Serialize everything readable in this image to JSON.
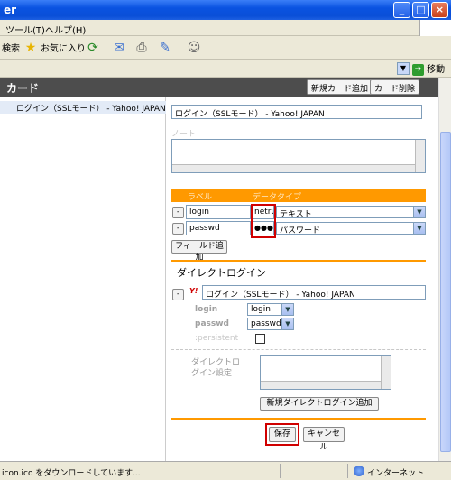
{
  "window": {
    "title": "er"
  },
  "menu": {
    "items": [
      "ツール(T)",
      "ヘルプ(H)"
    ]
  },
  "toolbar": {
    "search_label": "検索",
    "favorites_label": "お気に入り"
  },
  "addressbar": {
    "go_label": "移動"
  },
  "card": {
    "header_title": "カード",
    "new_card_label": "新規カード追加",
    "delete_card_label": "カード削除",
    "list_item": "ログイン（SSLモード） - Yahoo! JAPAN",
    "title_value": "ログイン（SSLモード） - Yahoo! JAPAN",
    "note_label": "ノート"
  },
  "fields": {
    "col_label": "ラベル",
    "col_datatype": "データタイプ",
    "rows": [
      {
        "remove": "-",
        "label": "login",
        "value": "netru",
        "type": "テキスト"
      },
      {
        "remove": "-",
        "label": "passwd",
        "value": "●●●●",
        "type": "パスワード"
      }
    ],
    "add_field_label": "フィールド追加"
  },
  "direct_login": {
    "section_title": "ダイレクトログイン",
    "remove": "-",
    "site_icon": "Y!",
    "site_title": "ログイン（SSLモード） - Yahoo! JAPAN",
    "params": [
      {
        "name": "login",
        "select": "login"
      },
      {
        "name": "passwd",
        "select": "passwd"
      }
    ],
    "persistent_label": ":persistent",
    "settings_label_line1": "ダイレクトロ",
    "settings_label_line2": "グイン設定",
    "add_direct_login_label": "新規ダイレクトログイン追加"
  },
  "actions": {
    "save_label": "保存",
    "cancel_label": "キャンセル"
  },
  "status": {
    "text": "icon.ico をダウンロードしています...",
    "zone": "インターネット"
  },
  "colors": {
    "accent": "#ff9900",
    "header": "#4d4d4d",
    "highlight": "#d00000"
  }
}
